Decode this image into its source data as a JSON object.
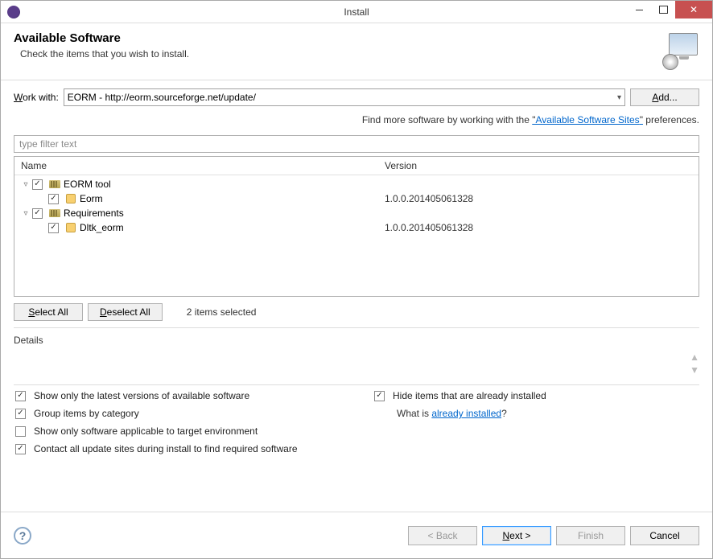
{
  "window": {
    "title": "Install"
  },
  "header": {
    "title": "Available Software",
    "subtitle": "Check the items that you wish to install."
  },
  "workwith": {
    "label": "Work with:",
    "value": "EORM - http://eorm.sourceforge.net/update/",
    "add_button": "Add..."
  },
  "findmore": {
    "prefix": "Find more software by working with the ",
    "link": "Available Software Sites",
    "suffix": " preferences."
  },
  "filter": {
    "placeholder": "type filter text"
  },
  "tree": {
    "columns": {
      "name": "Name",
      "version": "Version"
    },
    "rows": [
      {
        "indent": 0,
        "expander": "▿",
        "checked": true,
        "icon": "category",
        "label": "EORM tool",
        "version": ""
      },
      {
        "indent": 1,
        "expander": "",
        "checked": true,
        "icon": "item",
        "label": "Eorm",
        "version": "1.0.0.201405061328"
      },
      {
        "indent": 0,
        "expander": "▿",
        "checked": true,
        "icon": "category",
        "label": "Requirements",
        "version": ""
      },
      {
        "indent": 1,
        "expander": "",
        "checked": true,
        "icon": "item",
        "label": "Dltk_eorm",
        "version": "1.0.0.201405061328"
      }
    ]
  },
  "selection": {
    "select_all": "Select All",
    "deselect_all": "Deselect All",
    "count_text": "2 items selected"
  },
  "details": {
    "label": "Details"
  },
  "options": {
    "left": [
      {
        "checked": true,
        "label": "Show only the latest versions of available software"
      },
      {
        "checked": true,
        "label": "Group items by category"
      },
      {
        "checked": false,
        "label": "Show only software applicable to target environment"
      },
      {
        "checked": true,
        "label": "Contact all update sites during install to find required software"
      }
    ],
    "right": {
      "hide": {
        "checked": true,
        "label": "Hide items that are already installed"
      },
      "whatis_prefix": "What is ",
      "whatis_link": "already installed",
      "whatis_suffix": "?"
    }
  },
  "footer": {
    "back": "< Back",
    "next": "Next >",
    "finish": "Finish",
    "cancel": "Cancel"
  }
}
